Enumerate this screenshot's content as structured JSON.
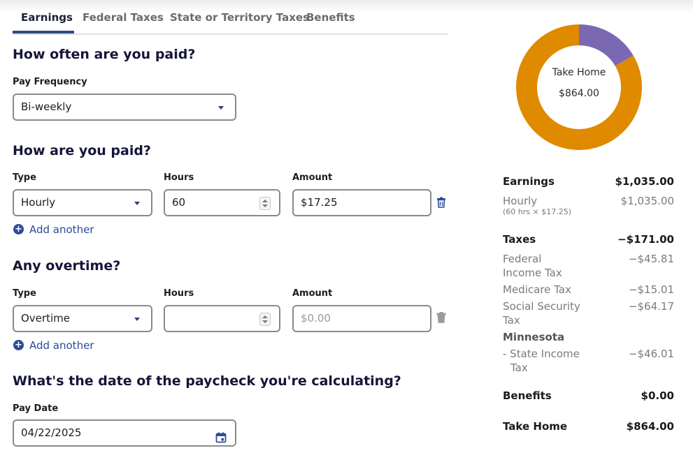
{
  "tabs": [
    {
      "label": "Earnings",
      "active": true
    },
    {
      "label": "Federal Taxes"
    },
    {
      "label": "State or Territory Taxes"
    },
    {
      "label": "Benefits"
    }
  ],
  "pay_frequency": {
    "heading": "How often are you paid?",
    "label": "Pay Frequency",
    "value": "Bi-weekly"
  },
  "pay": {
    "heading": "How are you paid?",
    "type_label": "Type",
    "hours_label": "Hours",
    "amount_label": "Amount",
    "type_value": "Hourly",
    "hours_value": "60",
    "amount_value": "$17.25",
    "add_label": "Add another"
  },
  "overtime": {
    "heading": "Any overtime?",
    "type_label": "Type",
    "hours_label": "Hours",
    "amount_label": "Amount",
    "type_value": "Overtime",
    "hours_value": "",
    "amount_placeholder": "$0.00",
    "add_label": "Add another"
  },
  "pay_date": {
    "heading": "What's the date of the paycheck you're calculating?",
    "label": "Pay Date",
    "value": "04/22/2025"
  },
  "donut": {
    "center_label": "Take Home",
    "center_value": "$864.00",
    "take_home_color": "#e08a00",
    "taxes_color": "#7b68b3",
    "take_home_fraction": 0.8348
  },
  "summary": {
    "earnings_label": "Earnings",
    "earnings_value": "$1,035.00",
    "hourly_label": "Hourly",
    "hourly_detail": "(60 hrs × $17.25)",
    "hourly_value": "$1,035.00",
    "taxes_label": "Taxes",
    "taxes_value": "−$171.00",
    "federal_label_1": "Federal",
    "federal_label_2": "Income Tax",
    "federal_value": "−$45.81",
    "medicare_label": "Medicare Tax",
    "medicare_value": "−$15.01",
    "ss_label_1": "Social Security",
    "ss_label_2": "Tax",
    "ss_value": "−$64.17",
    "state_name": "Minnesota",
    "state_label_1": "- State Income",
    "state_label_2": "Tax",
    "state_value": "−$46.01",
    "benefits_label": "Benefits",
    "benefits_value": "$0.00",
    "take_home_label": "Take Home",
    "take_home_value": "$864.00"
  }
}
